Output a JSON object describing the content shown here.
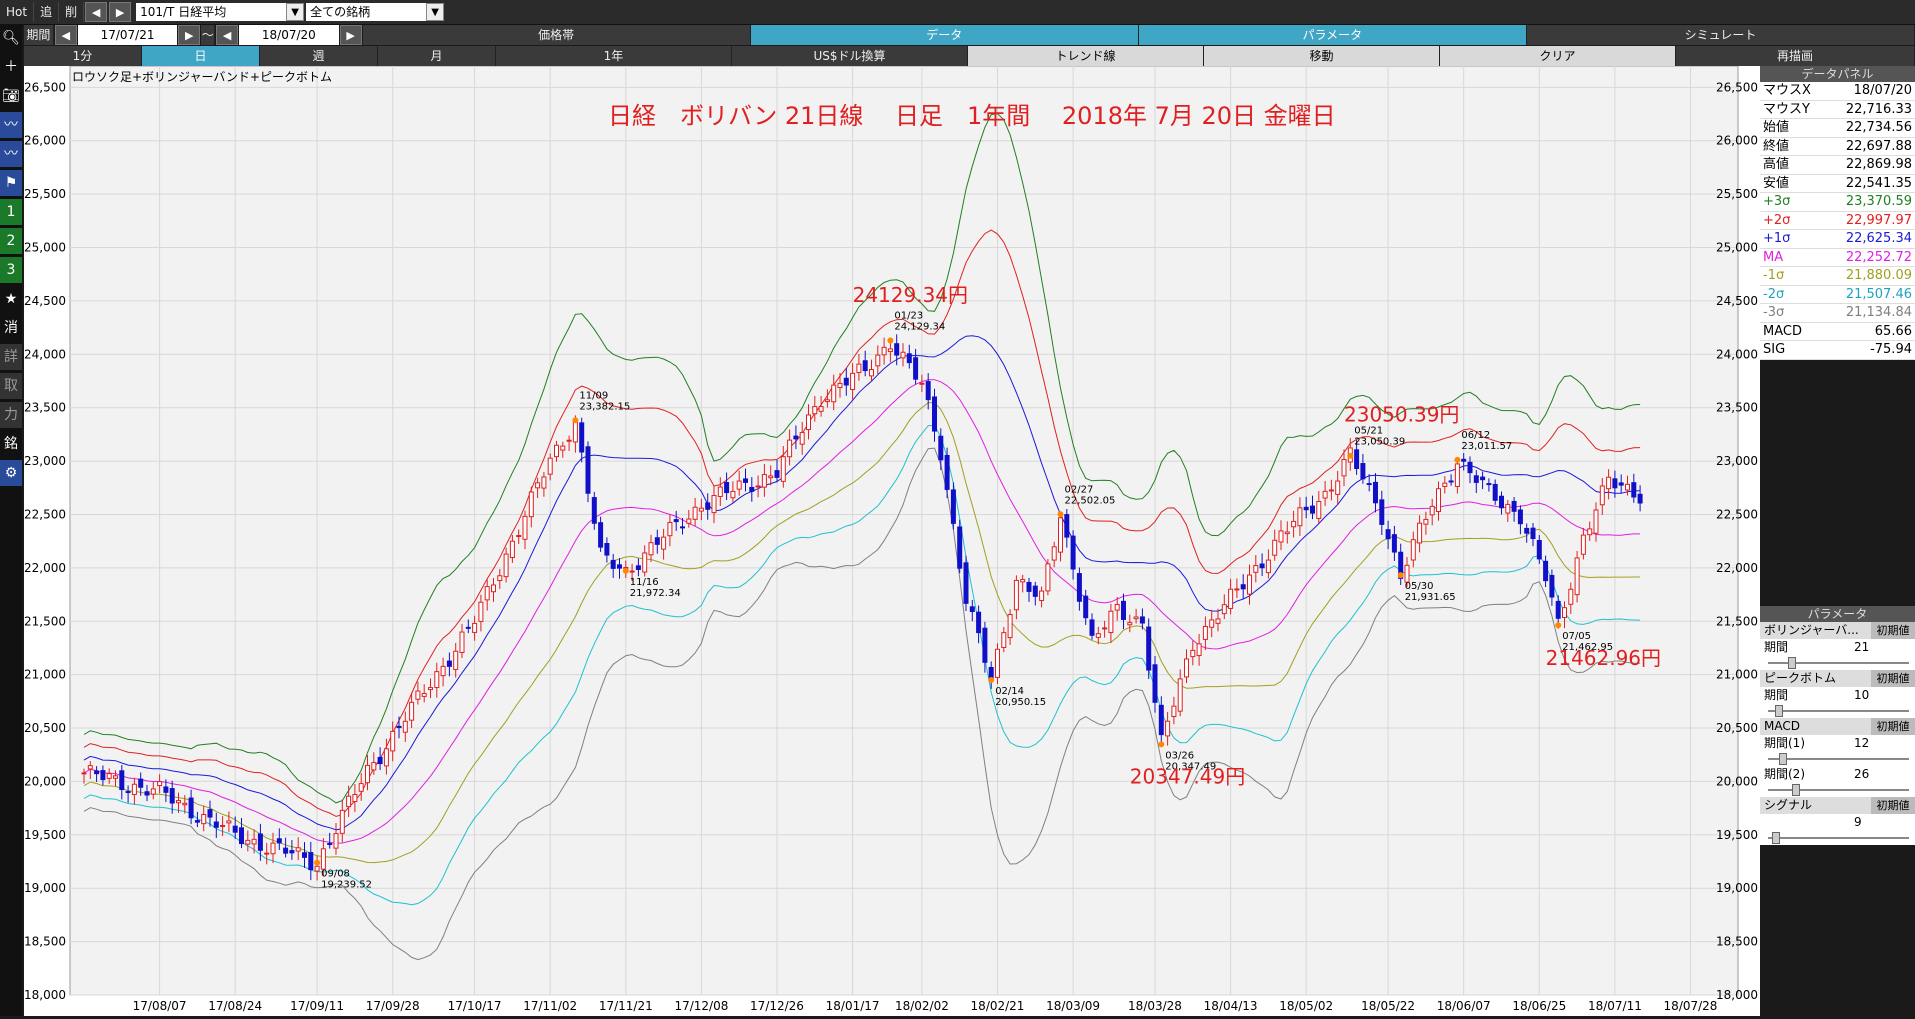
{
  "topbar": {
    "hot": "Hot",
    "add": "追",
    "delete": "削",
    "code": "101/T 日経平均",
    "filter": "全ての銘柄"
  },
  "period_row": {
    "label": "期間",
    "from": "17/07/21",
    "tilde": "～",
    "to": "18/07/20",
    "tabs": [
      "価格帯",
      "データ",
      "パラメータ",
      "シミュレート"
    ],
    "active_tab": "データ"
  },
  "interval_row": {
    "items": [
      "1分",
      "日",
      "週",
      "月",
      "1年",
      "US$ドル換算",
      "トレンド線",
      "移動",
      "クリア",
      "再描画"
    ],
    "active": "日"
  },
  "chart_data": {
    "type": "candlestick",
    "indicator_label": "ロウソク足+ボリンジャーバンド+ピークボトム",
    "annotation_title": "日経　ボリバン 21日線　 日足　1年間　 2018年 7月 20日 金曜日",
    "ylim": [
      18000,
      26700
    ],
    "yticks": [
      18000,
      18500,
      19000,
      19500,
      20000,
      20500,
      21000,
      21500,
      22000,
      22500,
      23000,
      23500,
      24000,
      24500,
      25000,
      25500,
      26000,
      26500
    ],
    "ytick_labels": [
      "18,000",
      "18,500",
      "19,000",
      "19,500",
      "20,000",
      "20,500",
      "21,000",
      "21,500",
      "22,000",
      "22,500",
      "23,000",
      "23,500",
      "24,000",
      "24,500",
      "25,000",
      "25,500",
      "26,000",
      "26,500"
    ],
    "xtick_labels": [
      "17/08/07",
      "17/08/24",
      "17/09/11",
      "17/09/28",
      "17/10/17",
      "17/11/02",
      "17/11/21",
      "17/12/08",
      "17/12/26",
      "18/01/17",
      "18/02/02",
      "18/02/21",
      "18/03/09",
      "18/03/28",
      "18/04/13",
      "18/05/02",
      "18/05/22",
      "18/06/07",
      "18/06/25",
      "18/07/11",
      "18/07/28"
    ],
    "xtick_idx": [
      12,
      24,
      37,
      49,
      62,
      74,
      86,
      98,
      110,
      122,
      133,
      145,
      157,
      170,
      182,
      194,
      207,
      219,
      231,
      243,
      255
    ],
    "n_bars": 248,
    "key_points": [
      [
        0,
        20080
      ],
      [
        12,
        19900
      ],
      [
        24,
        19500
      ],
      [
        37,
        19240
      ],
      [
        45,
        20100
      ],
      [
        62,
        21500
      ],
      [
        74,
        23000
      ],
      [
        78,
        23382
      ],
      [
        82,
        22100
      ],
      [
        86,
        21972
      ],
      [
        98,
        22600
      ],
      [
        110,
        22900
      ],
      [
        117,
        23600
      ],
      [
        124,
        23850
      ],
      [
        128,
        24129
      ],
      [
        133,
        23700
      ],
      [
        136,
        23100
      ],
      [
        140,
        21700
      ],
      [
        144,
        20950
      ],
      [
        148,
        21900
      ],
      [
        152,
        21700
      ],
      [
        155,
        22502
      ],
      [
        160,
        21300
      ],
      [
        164,
        21600
      ],
      [
        168,
        21500
      ],
      [
        171,
        20347
      ],
      [
        176,
        21300
      ],
      [
        182,
        21700
      ],
      [
        190,
        22300
      ],
      [
        197,
        22700
      ],
      [
        201,
        23050
      ],
      [
        206,
        22500
      ],
      [
        209,
        21931
      ],
      [
        214,
        22600
      ],
      [
        218,
        23011
      ],
      [
        223,
        22700
      ],
      [
        228,
        22500
      ],
      [
        232,
        21900
      ],
      [
        234,
        21463
      ],
      [
        238,
        22300
      ],
      [
        242,
        22800
      ],
      [
        247,
        22700
      ]
    ],
    "bands": {
      "ma": "MA",
      "plus1": "+1σ",
      "plus2": "+2σ",
      "plus3": "+3σ",
      "minus1": "-1σ",
      "minus2": "-2σ",
      "minus3": "-3σ"
    },
    "band_colors": {
      "ma": "#e020e0",
      "plus1": "#1a1ad8",
      "plus2": "#e02020",
      "plus3": "#208020",
      "minus1": "#a0a020",
      "minus2": "#20c0d0",
      "minus3": "#808080",
      "up": "#e02020",
      "down": "#1010c8"
    },
    "peaks": [
      {
        "idx": 78,
        "date": "11/09",
        "value": "23,382.15",
        "pos": "above"
      },
      {
        "idx": 86,
        "date": "11/16",
        "value": "21,972.34",
        "pos": "below"
      },
      {
        "idx": 37,
        "date": "09/08",
        "value": "19,239.52",
        "pos": "below"
      },
      {
        "idx": 128,
        "date": "01/23",
        "value": "24,129.34",
        "pos": "above"
      },
      {
        "idx": 144,
        "date": "02/14",
        "value": "20,950.15",
        "pos": "below"
      },
      {
        "idx": 155,
        "date": "02/27",
        "value": "22,502.05",
        "pos": "above"
      },
      {
        "idx": 171,
        "date": "03/26",
        "value": "20,347.49",
        "pos": "below"
      },
      {
        "idx": 201,
        "date": "05/21",
        "value": "23,050.39",
        "pos": "above"
      },
      {
        "idx": 209,
        "date": "05/30",
        "value": "21,931.65",
        "pos": "below"
      },
      {
        "idx": 218,
        "date": "06/12",
        "value": "23,011.57",
        "pos": "above"
      },
      {
        "idx": 234,
        "date": "07/05",
        "value": "21,462.95",
        "pos": "below"
      }
    ],
    "big_labels": [
      {
        "text": "24129.34円",
        "idx": 122,
        "value": 24490
      },
      {
        "text": "23050.39円",
        "idx": 200,
        "value": 23370
      },
      {
        "text": "21462.96円",
        "idx": 232,
        "value": 21090
      },
      {
        "text": "20347.49円",
        "idx": 166,
        "value": 19980
      }
    ]
  },
  "panel": {
    "title": "データパネル",
    "rows": [
      {
        "label": "マウスX",
        "value": "18/07/20",
        "color": "#000000"
      },
      {
        "label": "マウスY",
        "value": "22,716.33",
        "color": "#000000"
      },
      {
        "label": "始値",
        "value": "22,734.56",
        "color": "#000000"
      },
      {
        "label": "終値",
        "value": "22,697.88",
        "color": "#000000"
      },
      {
        "label": "高値",
        "value": "22,869.98",
        "color": "#000000"
      },
      {
        "label": "安値",
        "value": "22,541.35",
        "color": "#000000"
      },
      {
        "label": "+3σ",
        "value": "23,370.59",
        "color": "#208020"
      },
      {
        "label": "+2σ",
        "value": "22,997.97",
        "color": "#e02020"
      },
      {
        "label": "+1σ",
        "value": "22,625.34",
        "color": "#1a1ad8"
      },
      {
        "label": "MA",
        "value": "22,252.72",
        "color": "#e020e0"
      },
      {
        "label": "-1σ",
        "value": "21,880.09",
        "color": "#a0a020"
      },
      {
        "label": "-2σ",
        "value": "21,507.46",
        "color": "#20a0c0"
      },
      {
        "label": "-3σ",
        "value": "21,134.84",
        "color": "#808080"
      },
      {
        "label": "MACD",
        "value": "65.66",
        "color": "#000000"
      },
      {
        "label": "SIG",
        "value": "-75.94",
        "color": "#000000"
      }
    ],
    "params_title": "パラメータ",
    "reset_label": "初期値",
    "sections": [
      {
        "title": "ボリンジャーバ...",
        "fields": [
          {
            "label": "期間",
            "value": "21",
            "frac": 0.15
          }
        ]
      },
      {
        "title": "ピークボトム",
        "fields": [
          {
            "label": "期間",
            "value": "10",
            "frac": 0.05
          }
        ]
      },
      {
        "title": "MACD",
        "fields": [
          {
            "label": "期間(1)",
            "value": "12",
            "frac": 0.08
          },
          {
            "label": "期間(2)",
            "value": "26",
            "frac": 0.18
          }
        ]
      },
      {
        "title": "シグナル",
        "fields": [
          {
            "label": "",
            "value": "9",
            "frac": 0.03
          }
        ]
      }
    ]
  }
}
